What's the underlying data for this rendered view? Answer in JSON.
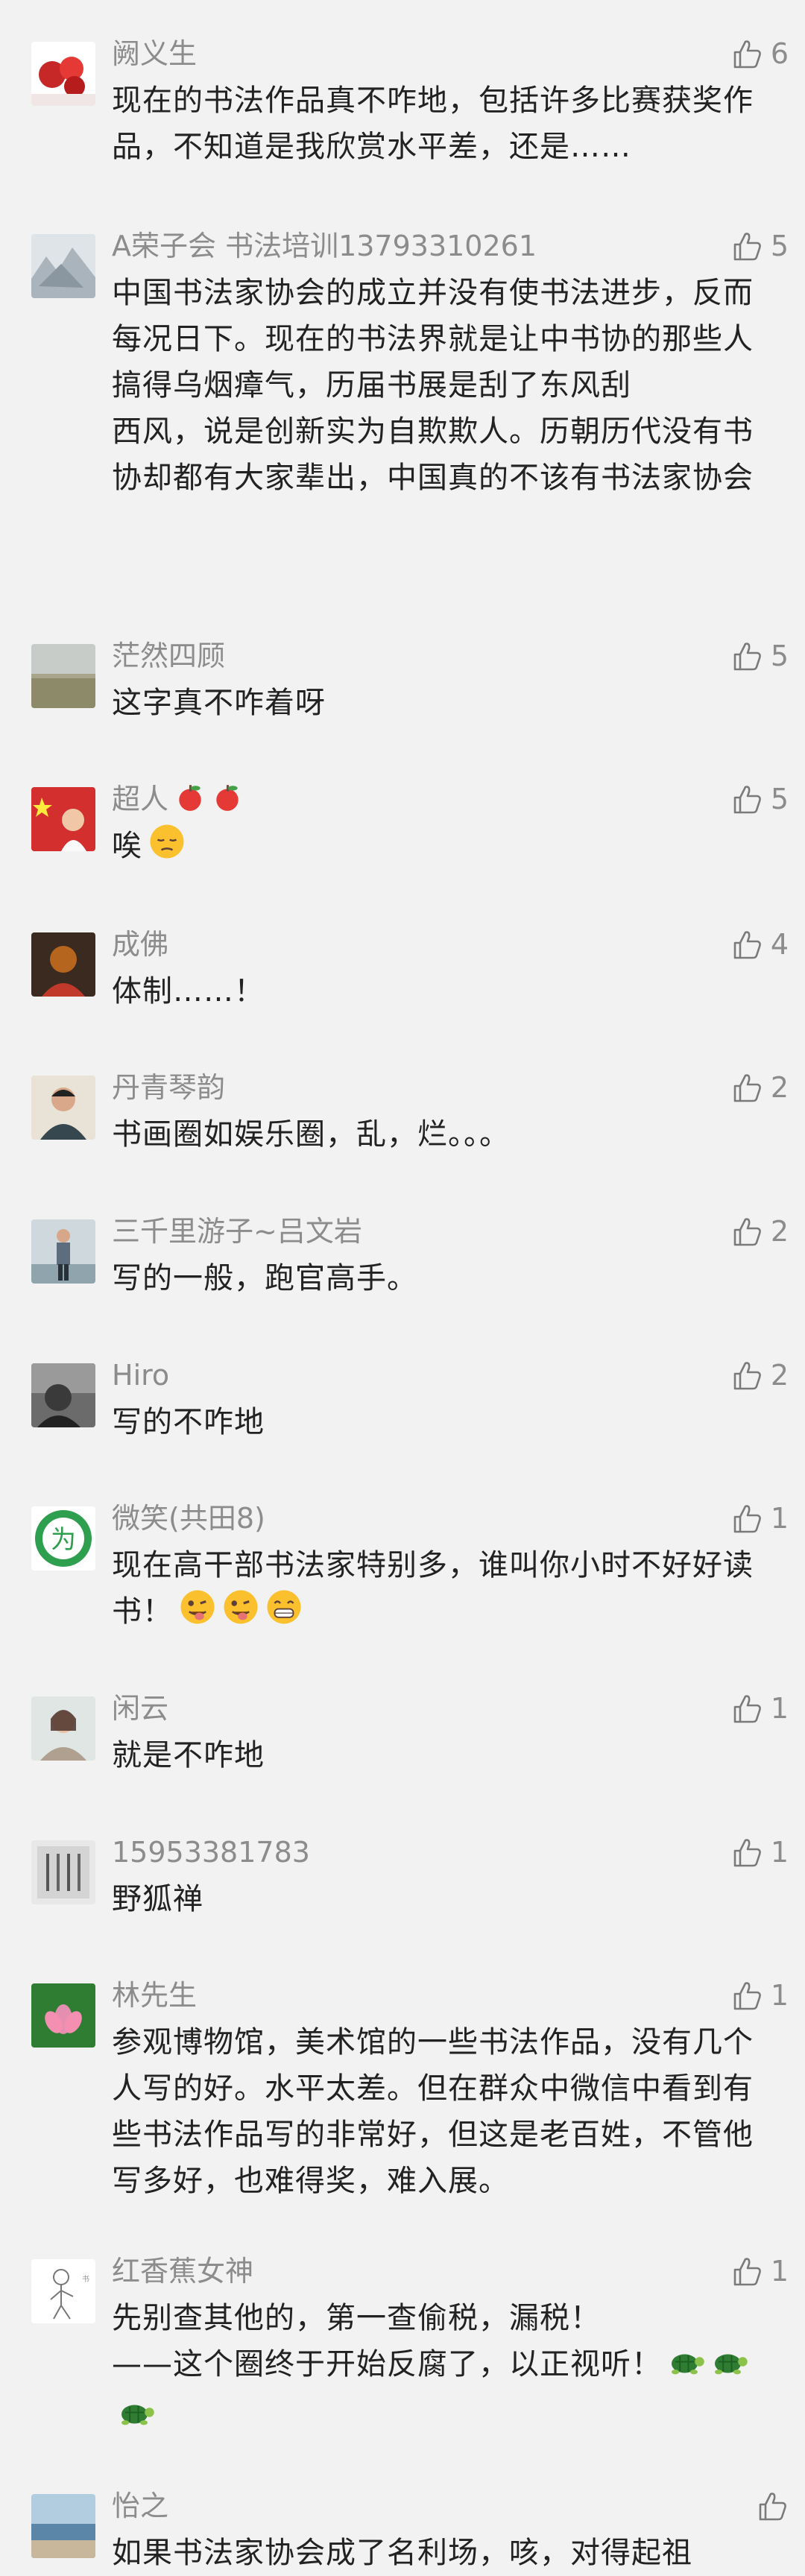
{
  "comments": [
    {
      "name": "阙义生",
      "text": "现在的书法作品真不咋地，包括许多比赛获奖作品，不知道是我欣赏水平差，还是……",
      "likes": "6",
      "avatar": "red-flower-avatar",
      "avatar_color": "#c62828"
    },
    {
      "name": "A荣子会 书法培训13793310261",
      "text": "中国书法家协会的成立并没有使书法进步，反而每况日下。现在的书法界就是让中书协的那些人搞得乌烟瘴气，历届书展是刮了东风刮\n西风，说是创新实为自欺欺人。历朝历代没有书协却都有大家辈出，中国真的不该有书法家协会",
      "likes": "5",
      "avatar": "ink-landscape-avatar",
      "avatar_color": "#a9b4bd"
    },
    {
      "name": "茫然四顾",
      "text": "这字真不咋着呀",
      "likes": "5",
      "avatar": "field-landscape-avatar",
      "avatar_color": "#8d8a6a"
    },
    {
      "name": "超人",
      "name_emoji": "apple-emoji",
      "text": "唉",
      "text_emoji": "pensive-face-emoji",
      "likes": "5",
      "avatar": "flag-person-avatar",
      "avatar_color": "#d32f2f"
    },
    {
      "name": "成佛",
      "text": "体制……！",
      "likes": "4",
      "avatar": "monk-avatar",
      "avatar_color": "#b5651d"
    },
    {
      "name": "丹青琴韵",
      "text": "书画圈如娱乐圈，乱，烂。。。",
      "likes": "2",
      "avatar": "man-portrait-avatar",
      "avatar_color": "#37474f"
    },
    {
      "name": "三千里游子~吕文岩",
      "text": "写的一般，跑官高手。",
      "likes": "2",
      "avatar": "standing-man-avatar",
      "avatar_color": "#5d6d7e"
    },
    {
      "name": "Hiro",
      "text": "写的不咋地",
      "likes": "2",
      "avatar": "dark-portrait-avatar",
      "avatar_color": "#3a3a3a"
    },
    {
      "name": "微笑(共田8)",
      "text": "现在高干部书法家特别多，谁叫你小时不好好读书！",
      "text_emoji": "tongue-face-emoji",
      "likes": "1",
      "avatar": "green-badge-avatar",
      "avatar_color": "#2e9e4f"
    },
    {
      "name": "闲云",
      "text": "就是不咋地",
      "likes": "1",
      "avatar": "woman-portrait-avatar",
      "avatar_color": "#b0a090"
    },
    {
      "name": "15953381783",
      "text": "野狐禅",
      "likes": "1",
      "avatar": "calligraphy-avatar",
      "avatar_color": "#9e9e9e"
    },
    {
      "name": "林先生",
      "text": "参观博物馆，美术馆的一些书法作品，没有几个人写的好。水平太差。但在群众中微信中看到有些书法作品写的非常好，但这是老百姓，不管他写多好，也难得奖，难入展。",
      "likes": "1",
      "avatar": "lotus-avatar",
      "avatar_color": "#e58fb0"
    },
    {
      "name": "红香蕉女神",
      "text": "先别查其他的，第一查偷税，漏税！\n——这个圈终于开始反腐了，以正视听！",
      "text_emoji": "turtle-emoji",
      "likes": "1",
      "avatar": "sketch-figure-avatar",
      "avatar_color": "#cfcfcf"
    },
    {
      "name": "怡之",
      "text": "如果书法家协会成了名利场，咳，对得起祖",
      "likes": "",
      "avatar": "seascape-avatar",
      "avatar_color": "#5b86a8"
    }
  ]
}
